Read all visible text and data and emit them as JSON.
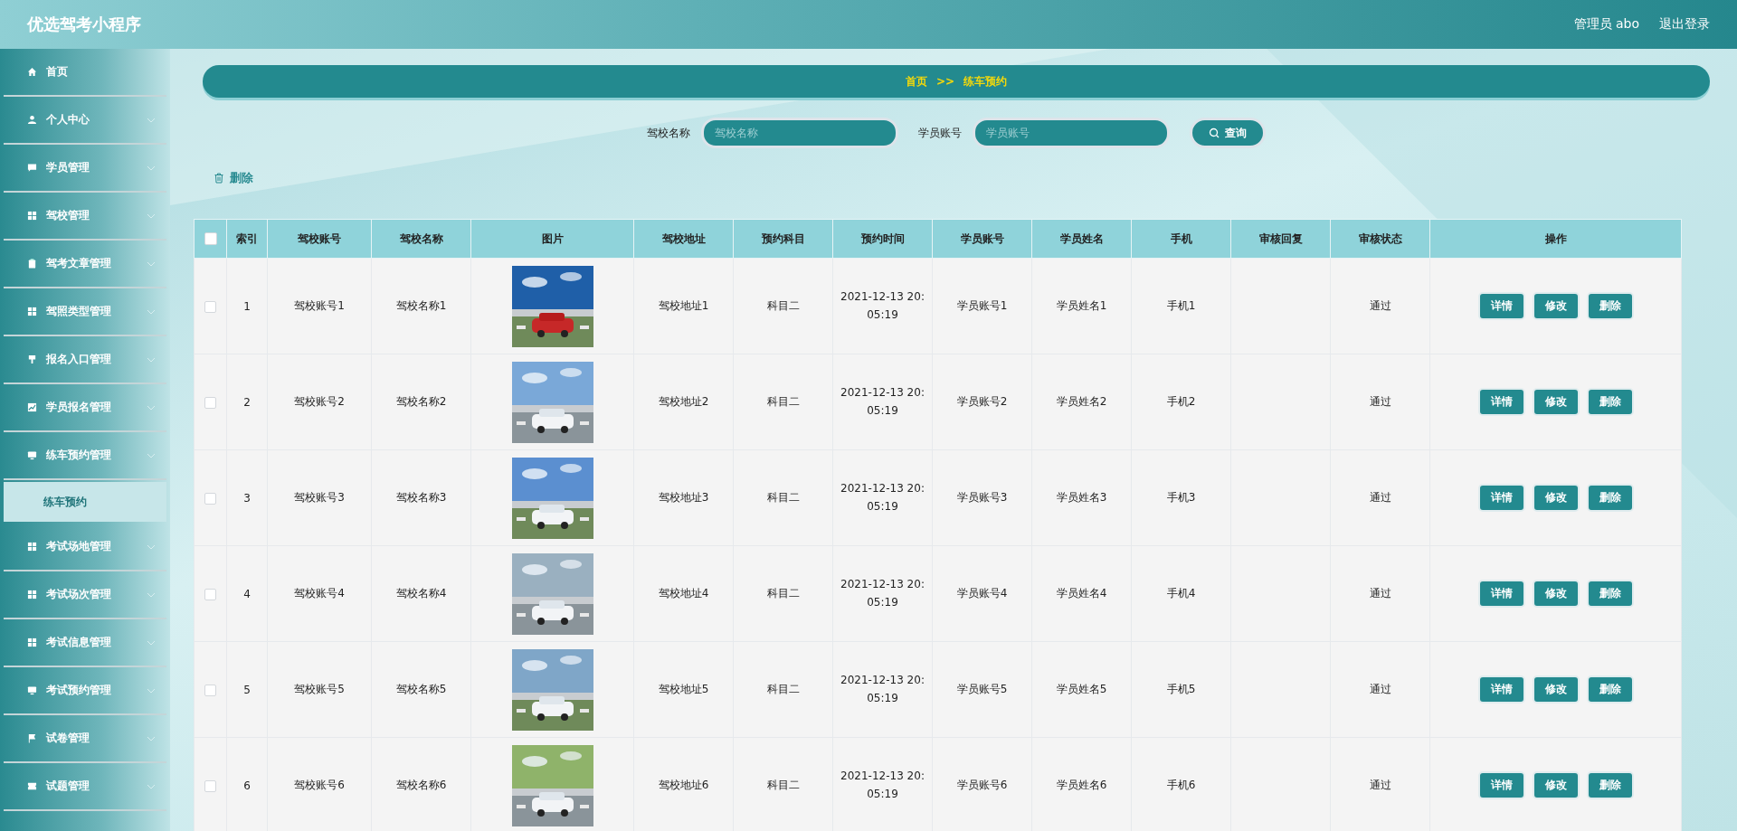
{
  "app_title": "优选驾考小程序",
  "header": {
    "user": "管理员 abo",
    "logout": "退出登录"
  },
  "sidebar": {
    "items": [
      {
        "label": "首页",
        "chevron": false
      },
      {
        "label": "个人中心",
        "chevron": true
      },
      {
        "label": "学员管理",
        "chevron": true
      },
      {
        "label": "驾校管理",
        "chevron": true
      },
      {
        "label": "驾考文章管理",
        "chevron": true
      },
      {
        "label": "驾照类型管理",
        "chevron": true
      },
      {
        "label": "报名入口管理",
        "chevron": true
      },
      {
        "label": "学员报名管理",
        "chevron": true
      },
      {
        "label": "练车预约管理",
        "chevron": true,
        "children": [
          {
            "label": "练车预约",
            "selected": true
          }
        ]
      },
      {
        "label": "考试场地管理",
        "chevron": true
      },
      {
        "label": "考试场次管理",
        "chevron": true
      },
      {
        "label": "考试信息管理",
        "chevron": true
      },
      {
        "label": "考试预约管理",
        "chevron": true
      },
      {
        "label": "试卷管理",
        "chevron": true
      },
      {
        "label": "试题管理",
        "chevron": true
      }
    ]
  },
  "breadcrumb": {
    "home": "首页",
    "separator": ">>",
    "current": "练车预约"
  },
  "search": {
    "fields": [
      {
        "label": "驾校名称",
        "placeholder": "驾校名称"
      },
      {
        "label": "学员账号",
        "placeholder": "学员账号"
      }
    ],
    "button": "查询"
  },
  "delete_button": "删除",
  "table": {
    "header_checked": false,
    "columns": [
      "索引",
      "驾校账号",
      "驾校名称",
      "图片",
      "驾校地址",
      "预约科目",
      "预约时间",
      "学员账号",
      "学员姓名",
      "手机",
      "审核回复",
      "审核状态",
      "操作"
    ],
    "rows": [
      {
        "checked": false,
        "index": "1",
        "school_account": "驾校账号1",
        "school_name": "驾校名称1",
        "address": "驾校地址1",
        "subject": "科目二",
        "time": "2021-12-13 20:05:19",
        "student_account": "学员账号1",
        "student_name": "学员姓名1",
        "phone": "手机1",
        "status": "通过",
        "actions": [
          "详情",
          "修改",
          "删除"
        ]
      },
      {
        "checked": false,
        "index": "2",
        "school_account": "驾校账号2",
        "school_name": "驾校名称2",
        "address": "驾校地址2",
        "subject": "科目二",
        "time": "2021-12-13 20:05:19",
        "student_account": "学员账号2",
        "student_name": "学员姓名2",
        "phone": "手机2",
        "status": "通过",
        "actions": [
          "详情",
          "修改",
          "删除"
        ]
      },
      {
        "checked": false,
        "index": "3",
        "school_account": "驾校账号3",
        "school_name": "驾校名称3",
        "address": "驾校地址3",
        "subject": "科目二",
        "time": "2021-12-13 20:05:19",
        "student_account": "学员账号3",
        "student_name": "学员姓名3",
        "phone": "手机3",
        "status": "通过",
        "actions": [
          "详情",
          "修改",
          "删除"
        ]
      },
      {
        "checked": false,
        "index": "4",
        "school_account": "驾校账号4",
        "school_name": "驾校名称4",
        "address": "驾校地址4",
        "subject": "科目二",
        "time": "2021-12-13 20:05:19",
        "student_account": "学员账号4",
        "student_name": "学员姓名4",
        "phone": "手机4",
        "status": "通过",
        "actions": [
          "详情",
          "修改",
          "删除"
        ]
      },
      {
        "checked": false,
        "index": "5",
        "school_account": "驾校账号5",
        "school_name": "驾校名称5",
        "address": "驾校地址5",
        "subject": "科目二",
        "time": "2021-12-13 20:05:19",
        "student_account": "学员账号5",
        "student_name": "学员姓名5",
        "phone": "手机5",
        "status": "通过",
        "actions": [
          "详情",
          "修改",
          "删除"
        ]
      },
      {
        "checked": false,
        "index": "6",
        "school_account": "驾校账号6",
        "school_name": "驾校名称6",
        "address": "驾校地址6",
        "subject": "科目二",
        "time": "2021-12-13 20:05:19",
        "student_account": "学员账号6",
        "student_name": "学员姓名6",
        "phone": "手机6",
        "status": "通过",
        "actions": [
          "详情",
          "修改",
          "删除"
        ]
      }
    ]
  }
}
